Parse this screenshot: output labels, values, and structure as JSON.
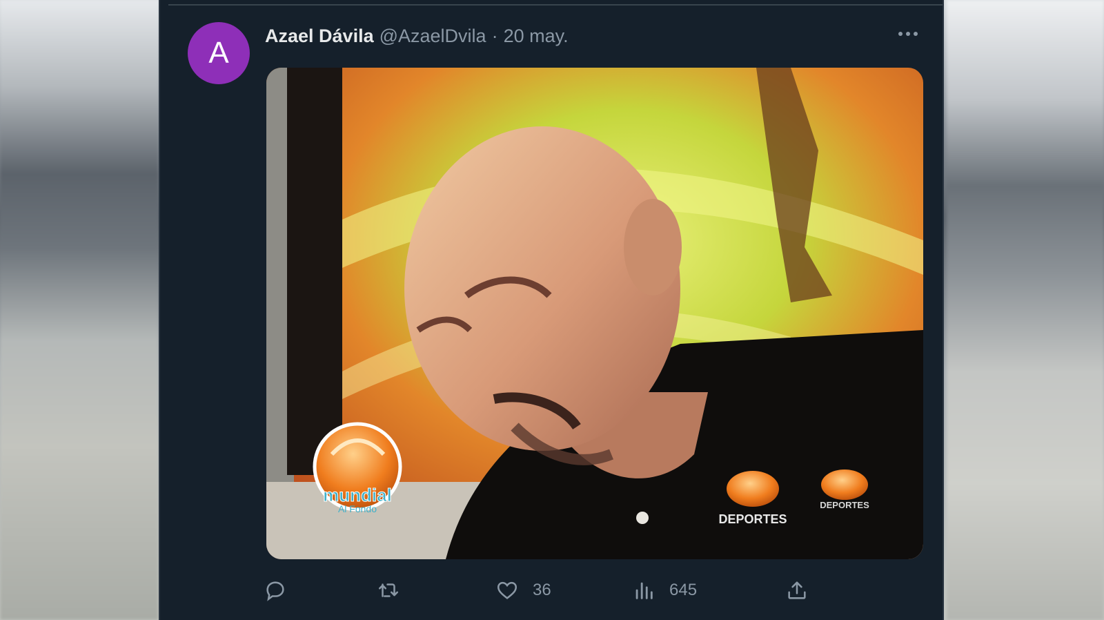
{
  "tweet": {
    "avatar_letter": "A",
    "avatar_color": "#8e2fb8",
    "author_name": "Azael Dávila",
    "handle": "@AzaelDvila",
    "separator": "·",
    "date": "20 may.",
    "media": {
      "watermark_left": "mundial",
      "watermark_left_sub": "Al Fondo",
      "logo_right_1": "DEPORTES",
      "logo_right_2": "DEPORTES"
    },
    "actions": {
      "reply_icon": "reply-icon",
      "retweet_icon": "retweet-icon",
      "like_icon": "heart-icon",
      "like_count": "36",
      "views_icon": "views-icon",
      "views_count": "645",
      "share_icon": "share-icon"
    }
  },
  "colors": {
    "background": "#15202b",
    "text_primary": "#e7e9ea",
    "text_secondary": "#8b98a5"
  }
}
